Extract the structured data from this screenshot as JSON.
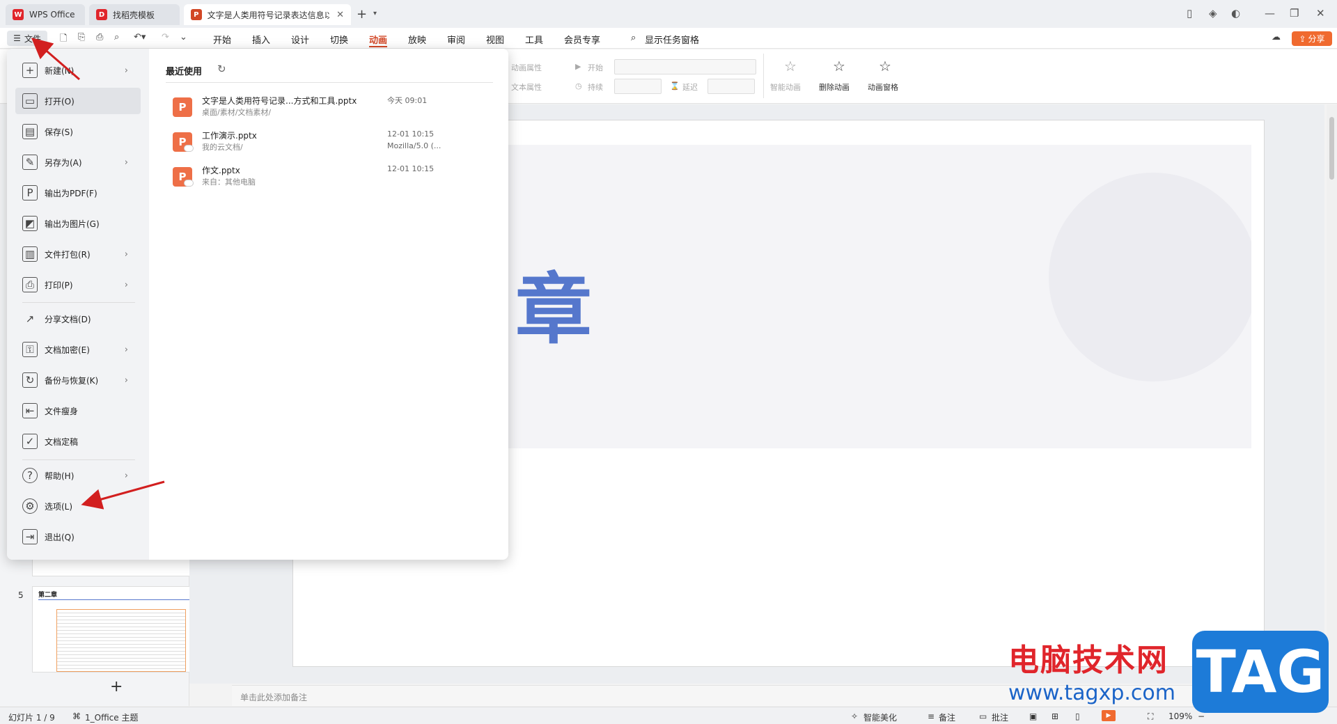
{
  "tabs": [
    {
      "label": "WPS Office",
      "logo": "W",
      "color": "#e0252b"
    },
    {
      "label": "找稻壳模板",
      "logo": "D",
      "color": "#e0252b"
    },
    {
      "label": "文字是人类用符号记录表达信息以",
      "logo": "P",
      "color": "#d24726"
    }
  ],
  "menubar": {
    "file_label": "文件",
    "items": [
      "开始",
      "插入",
      "设计",
      "切换",
      "动画",
      "放映",
      "审阅",
      "视图",
      "工具",
      "会员专享"
    ],
    "active": "动画",
    "task_pane": "显示任务窗格",
    "share": "分享"
  },
  "ribbon": {
    "anim_prop": "动画属性",
    "text_prop": "文本属性",
    "start": "开始",
    "duration": "持续",
    "delay": "延迟",
    "smart_anim": "智能动画",
    "delete_anim": "删除动画",
    "anim_pane": "动画窗格"
  },
  "file_menu": {
    "items": [
      {
        "label": "新建(N)",
        "icon": "plus-icon",
        "arrow": true
      },
      {
        "label": "打开(O)",
        "icon": "folder-icon",
        "arrow": false
      },
      {
        "label": "保存(S)",
        "icon": "save-icon",
        "arrow": false
      },
      {
        "label": "另存为(A)",
        "icon": "save-as-icon",
        "arrow": true
      },
      {
        "label": "输出为PDF(F)",
        "icon": "pdf-icon",
        "arrow": false
      },
      {
        "label": "输出为图片(G)",
        "icon": "image-icon",
        "arrow": false
      },
      {
        "label": "文件打包(R)",
        "icon": "package-icon",
        "arrow": true
      },
      {
        "label": "打印(P)",
        "icon": "printer-icon",
        "arrow": true
      },
      {
        "label": "分享文档(D)",
        "icon": "share-icon",
        "arrow": false
      },
      {
        "label": "文档加密(E)",
        "icon": "lock-icon",
        "arrow": true
      },
      {
        "label": "备份与恢复(K)",
        "icon": "backup-icon",
        "arrow": true
      },
      {
        "label": "文件瘦身",
        "icon": "slim-icon",
        "arrow": false
      },
      {
        "label": "文档定稿",
        "icon": "finalize-icon",
        "arrow": false
      },
      {
        "label": "帮助(H)",
        "icon": "help-icon",
        "arrow": true
      },
      {
        "label": "选项(L)",
        "icon": "gear-icon",
        "arrow": false
      },
      {
        "label": "退出(Q)",
        "icon": "exit-icon",
        "arrow": false
      }
    ],
    "recent_title": "最近使用",
    "recent_files": [
      {
        "name": "文字是人类用符号记录...方式和工具.pptx",
        "path": "桌面/素材/文档素材/",
        "time": "今天  09:01",
        "source": ""
      },
      {
        "name": "工作演示.pptx",
        "path": "我的云文档/",
        "time": "12-01 10:15",
        "source": "Mozilla/5.0 (..."
      },
      {
        "name": "作文.pptx",
        "path": "来自：其他电脑",
        "time": "12-01 10:15",
        "source": ""
      }
    ]
  },
  "slides": {
    "thumb5_title": "第二章",
    "thumb_numbers": [
      "5"
    ],
    "main_char": "章"
  },
  "notes_placeholder": "单击此处添加备注",
  "status": {
    "slide_info": "幻灯片 1 / 9",
    "theme": "1_Office 主题",
    "beautify": "智能美化",
    "notes": "备注",
    "comment": "批注",
    "zoom": "109%"
  },
  "watermark": {
    "site_name": "电脑技术网",
    "url": "www.tagxp.com",
    "tag": "TAG"
  }
}
